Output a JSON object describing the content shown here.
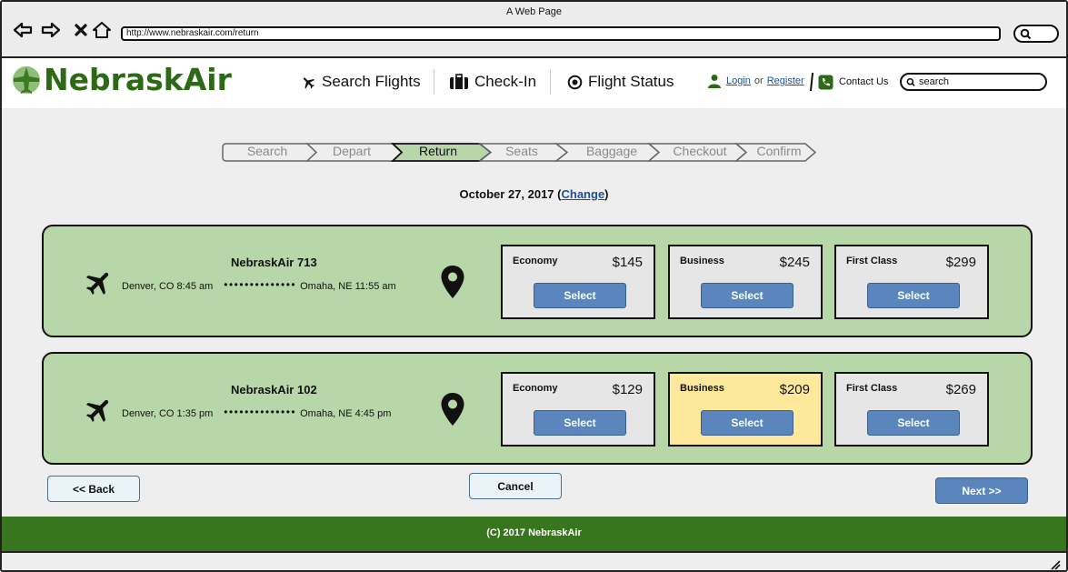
{
  "window": {
    "title": "A Web Page"
  },
  "browser": {
    "url": "http://www.nebraskair.com/return"
  },
  "site": {
    "brand": "NebraskAir",
    "brand_color": "#2d6a16",
    "nav": [
      {
        "label": "Search Flights",
        "icon": "airplane-icon"
      },
      {
        "label": "Check-In",
        "icon": "suitcase-icon"
      },
      {
        "label": "Flight Status",
        "icon": "target-icon"
      }
    ],
    "login_label": "Login",
    "or_label": "or",
    "register_label": "Register",
    "contact_label": "Contact Us",
    "search_placeholder": "search"
  },
  "steps": {
    "items": [
      "Search",
      "Depart",
      "Return",
      "Seats",
      "Baggage",
      "Checkout",
      "Confirm"
    ],
    "active": "Return",
    "active_color": "#b7d7a8"
  },
  "date": {
    "text": "October 27, 2017",
    "change_label": "Change"
  },
  "flights": [
    {
      "name": "NebraskAir 713",
      "from": "Denver, CO 8:45 am",
      "to": "Omaha, NE 11:55 am",
      "fares": [
        {
          "class": "Economy",
          "price": "$145",
          "button": "Select"
        },
        {
          "class": "Business",
          "price": "$245",
          "button": "Select"
        },
        {
          "class": "First Class",
          "price": "$299",
          "button": "Select"
        }
      ]
    },
    {
      "name": "NebraskAir 102",
      "from": "Denver, CO 1:35 pm",
      "to": "Omaha, NE 4:45 pm",
      "selected_fare": "Business",
      "fares": [
        {
          "class": "Economy",
          "price": "$129",
          "button": "Select"
        },
        {
          "class": "Business",
          "price": "$209",
          "button": "Select"
        },
        {
          "class": "First Class",
          "price": "$269",
          "button": "Select"
        }
      ]
    }
  ],
  "buttons": {
    "back": "<< Back",
    "cancel": "Cancel",
    "next": "Next >>"
  },
  "footer": {
    "text": "(C) 2017 NebraskAir",
    "color": "#38761d"
  }
}
